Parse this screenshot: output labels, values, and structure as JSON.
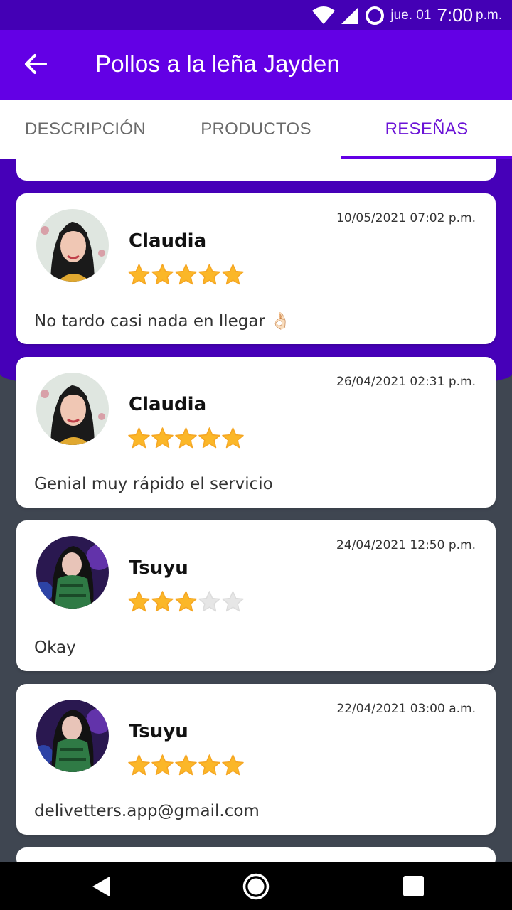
{
  "status_bar": {
    "date": "jue. 01",
    "time": "7:00",
    "ampm": "p.m.",
    "icons": [
      "wifi-icon",
      "signal-icon",
      "circle-status-icon"
    ]
  },
  "app_bar": {
    "title": "Pollos a la leña Jayden",
    "back_icon": "arrow-left-icon"
  },
  "tabs": [
    {
      "label": "DESCRIPCIÓN",
      "active": false
    },
    {
      "label": "PRODUCTOS",
      "active": false
    },
    {
      "label": "RESEÑAS",
      "active": true
    }
  ],
  "reviews": [
    {
      "name": "Claudia",
      "date": "10/05/2021 07:02 p.m.",
      "rating": 5,
      "text": "No tardo casi nada en llegar 👌🏻",
      "avatar": "avatar-claudia"
    },
    {
      "name": "Claudia",
      "date": "26/04/2021 02:31 p.m.",
      "rating": 5,
      "text": "Genial muy rápido el servicio",
      "avatar": "avatar-claudia"
    },
    {
      "name": "Tsuyu",
      "date": "24/04/2021 12:50 p.m.",
      "rating": 3,
      "text": "Okay",
      "avatar": "avatar-tsuyu"
    },
    {
      "name": "Tsuyu",
      "date": "22/04/2021 03:00 a.m.",
      "rating": 5,
      "text": "delivetters.app@gmail.com",
      "avatar": "avatar-tsuyu"
    }
  ],
  "colors": {
    "primary": "#6300e5",
    "primary_dark": "#4600b8",
    "accent_tab": "#6a12d6",
    "star_filled": "#fbb728",
    "star_empty": "#e6e6e6",
    "background": "#3f4651"
  },
  "nav_bar": {
    "icons": [
      "back-triangle-icon",
      "home-circle-icon",
      "recents-square-icon"
    ]
  }
}
